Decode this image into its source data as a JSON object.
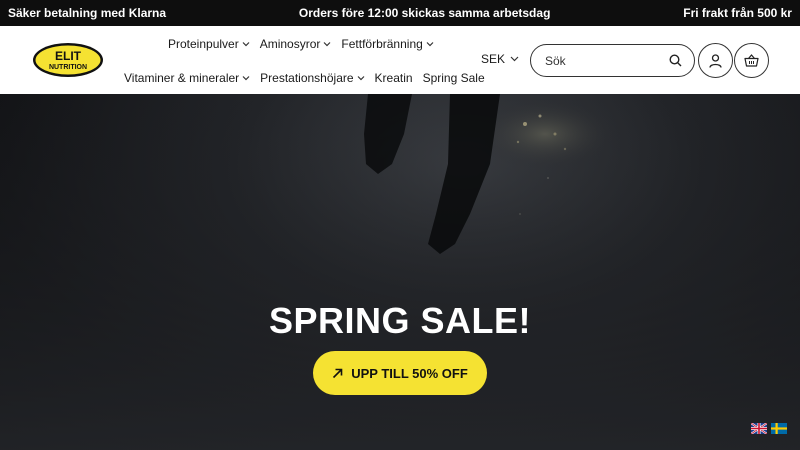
{
  "topbar": {
    "left": "Säker betalning med Klarna",
    "center": "Orders före 12:00 skickas samma arbetsdag",
    "right": "Fri frakt från 500 kr"
  },
  "logo": {
    "line1": "ELIT",
    "line2": "NUTRITION",
    "brand_color": "#f5e232"
  },
  "nav": {
    "row1": [
      {
        "label": "Proteinpulver",
        "dropdown": true
      },
      {
        "label": "Aminosyror",
        "dropdown": true
      },
      {
        "label": "Fettförbränning",
        "dropdown": true
      }
    ],
    "row2": [
      {
        "label": "Vitaminer & mineraler",
        "dropdown": true
      },
      {
        "label": "Prestationshöjare",
        "dropdown": true
      },
      {
        "label": "Kreatin",
        "dropdown": false
      },
      {
        "label": "Spring Sale",
        "dropdown": false
      }
    ]
  },
  "currency": {
    "value": "SEK"
  },
  "search": {
    "placeholder": "Sök",
    "value": "",
    "icon": "search-icon"
  },
  "account": {
    "icon": "user-icon"
  },
  "cart": {
    "icon": "basket-icon"
  },
  "hero": {
    "title": "SPRING SALE!",
    "cta_label": "UPP TILL 50% OFF",
    "cta_icon": "arrow-up-right-icon",
    "cta_color": "#f5e232"
  },
  "languages": [
    {
      "icon": "uk-flag-icon"
    },
    {
      "icon": "sweden-flag-icon"
    }
  ]
}
